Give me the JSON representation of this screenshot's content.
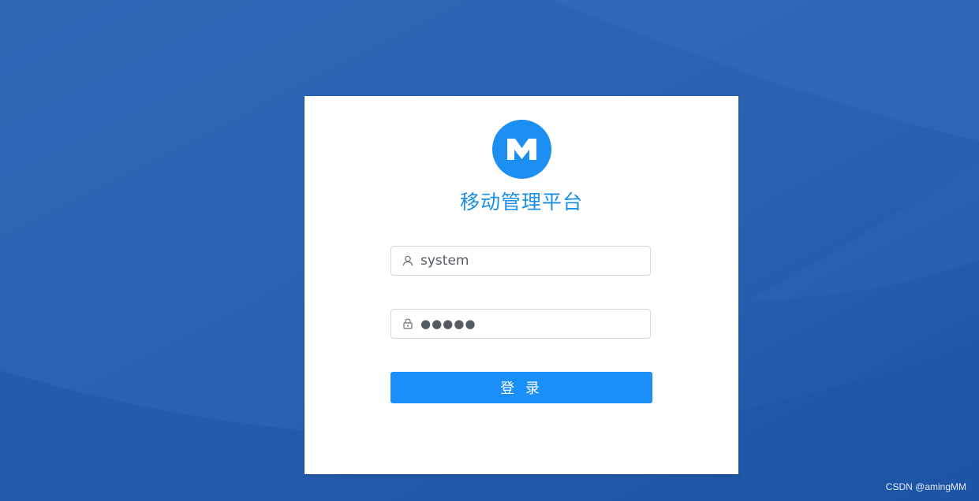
{
  "app": {
    "title": "移动管理平台",
    "logo_letter": "M",
    "logo_color": "#1b8ff2",
    "title_color": "#1a8fe8"
  },
  "form": {
    "username_value": "system",
    "password_value": "●●●●●",
    "username_icon": "user-icon",
    "password_icon": "lock-icon",
    "login_label": "登 录",
    "button_color": "#1a8ff8"
  },
  "background": {
    "color": "#245eb0"
  },
  "watermark": {
    "text": "CSDN @amingMM"
  }
}
